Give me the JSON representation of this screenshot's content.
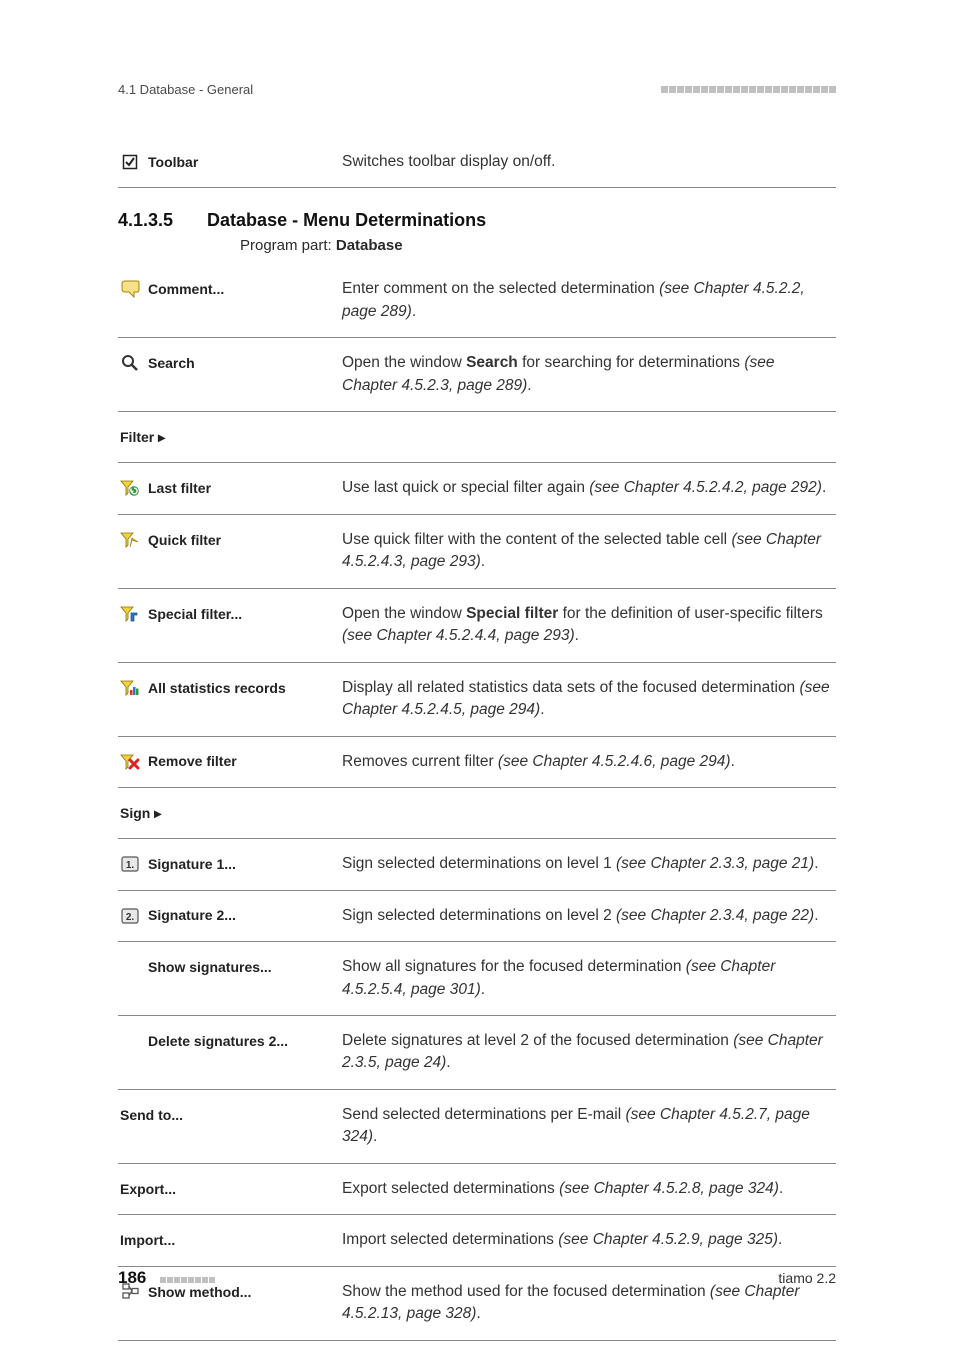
{
  "header": {
    "left": "4.1 Database - General"
  },
  "preRow": {
    "label": "Toolbar",
    "desc": "Switches toolbar display on/off."
  },
  "section": {
    "number": "4.1.3.5",
    "title": "Database - Menu Determinations",
    "subPrefix": "Program part: ",
    "subBold": "Database"
  },
  "rows": [
    {
      "icon": "comment-icon",
      "label": "Comment...",
      "indent": 0,
      "desc": "Enter comment on the selected determination ",
      "descItalic": "(see Chapter 4.5.2.2, page 289)",
      "descSuffix": "."
    },
    {
      "icon": "search-icon",
      "label": "Search",
      "indent": 0,
      "desc": "Open the window ",
      "descBold": "Search",
      "descMid": " for searching for determinations ",
      "descItalic": "(see Chapter 4.5.2.3, page 289)",
      "descSuffix": "."
    },
    {
      "icon": "",
      "label": "Filter ▸",
      "indent": 1,
      "desc": ""
    },
    {
      "icon": "last-filter-icon",
      "label": "Last filter",
      "indent": 2,
      "desc": "Use last quick or special filter again ",
      "descItalic": "(see Chapter 4.5.2.4.2, page 292)",
      "descSuffix": "."
    },
    {
      "icon": "quick-filter-icon",
      "label": "Quick filter",
      "indent": 2,
      "desc": "Use quick filter with the content of the selected table cell ",
      "descItalic": "(see Chapter 4.5.2.4.3, page 293)",
      "descSuffix": "."
    },
    {
      "icon": "special-filter-icon",
      "label": "Special filter...",
      "indent": 2,
      "desc": "Open the window ",
      "descBold": "Special filter",
      "descMid": " for the definition of user-specific filters ",
      "descItalic": "(see Chapter 4.5.2.4.4, page 293)",
      "descSuffix": "."
    },
    {
      "icon": "stats-icon",
      "label": "All statistics records",
      "indent": 2,
      "desc": "Display all related statistics data sets of the focused determination ",
      "descItalic": "(see Chapter 4.5.2.4.5, page 294)",
      "descSuffix": "."
    },
    {
      "icon": "remove-filter-icon",
      "label": "Remove filter",
      "indent": 2,
      "desc": "Removes current filter ",
      "descItalic": "(see Chapter 4.5.2.4.6, page 294)",
      "descSuffix": "."
    },
    {
      "icon": "",
      "label": "Sign ▸",
      "indent": 1,
      "desc": ""
    },
    {
      "icon": "signature-1-icon",
      "label": "Signature 1...",
      "indent": 2,
      "desc": "Sign selected determinations on level 1 ",
      "descItalic": "(see Chapter 2.3.3, page 21)",
      "descSuffix": "."
    },
    {
      "icon": "signature-2-icon",
      "label": "Signature 2...",
      "indent": 2,
      "desc": "Sign selected determinations on level 2 ",
      "descItalic": "(see Chapter 2.3.4, page 22)",
      "descSuffix": "."
    },
    {
      "icon": "",
      "label": "Show signatures...",
      "indent": 2,
      "desc": "Show all signatures for the focused determination ",
      "descItalic": "(see Chapter 4.5.2.5.4, page 301)",
      "descSuffix": "."
    },
    {
      "icon": "",
      "label": "Delete signatures 2...",
      "indent": 2,
      "desc": "Delete signatures at level 2 of the focused determination ",
      "descItalic": "(see Chapter 2.3.5, page 24)",
      "descSuffix": "."
    },
    {
      "icon": "",
      "label": "Send to...",
      "indent": 1,
      "desc": "Send selected determinations per E-mail ",
      "descItalic": "(see Chapter 4.5.2.7, page 324)",
      "descSuffix": "."
    },
    {
      "icon": "",
      "label": "Export...",
      "indent": 1,
      "desc": "Export selected determinations ",
      "descItalic": "(see Chapter 4.5.2.8, page 324)",
      "descSuffix": "."
    },
    {
      "icon": "",
      "label": "Import...",
      "indent": 1,
      "desc": "Import selected determinations ",
      "descItalic": "(see Chapter 4.5.2.9, page 325)",
      "descSuffix": "."
    },
    {
      "icon": "show-method-icon",
      "label": "Show method...",
      "indent": 0,
      "desc": "Show the method used for the focused determination ",
      "descItalic": "(see Chapter 4.5.2.13, page 328)",
      "descSuffix": "."
    }
  ],
  "footer": {
    "page": "186",
    "right": "tiamo 2.2"
  }
}
